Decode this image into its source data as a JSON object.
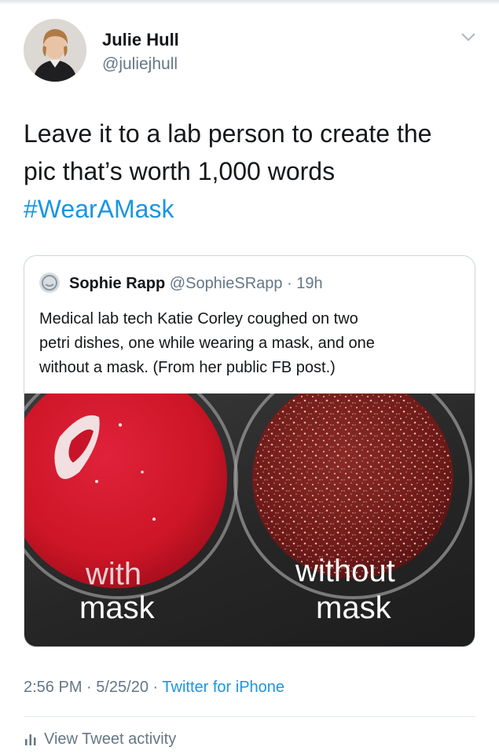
{
  "tweet": {
    "author_name": "Julie Hull",
    "author_handle": "@juliejhull",
    "text_lines": [
      "Leave it to a lab person to create the",
      "pic that’s worth 1,000 words"
    ],
    "hashtag": "#WearAMask",
    "timestamp": "2:56 PM · 5/25/20 · ",
    "source": "Twitter for iPhone",
    "activity_label": "View Tweet activity"
  },
  "quoted_tweet": {
    "author_name": "Sophie Rapp",
    "author_handle": "@SophieSRapp",
    "time": " · 19h",
    "text_lines": [
      "Medical lab tech Katie Corley coughed on two",
      "petri dishes, one while wearing a mask, and one",
      "without a mask. (From her public FB post.)"
    ],
    "photo": {
      "left_label_top": "with",
      "left_label_bottom": "mask",
      "right_label_top": "without",
      "right_label_bottom": "mask"
    }
  },
  "colors": {
    "link": "#1b95e0",
    "secondary_text": "#657786",
    "agar_red": "#d0172a",
    "contaminated_agar": "#7a1d1c"
  },
  "icons": {
    "menu": "chevron-down-icon",
    "activity": "bar-chart-icon"
  }
}
